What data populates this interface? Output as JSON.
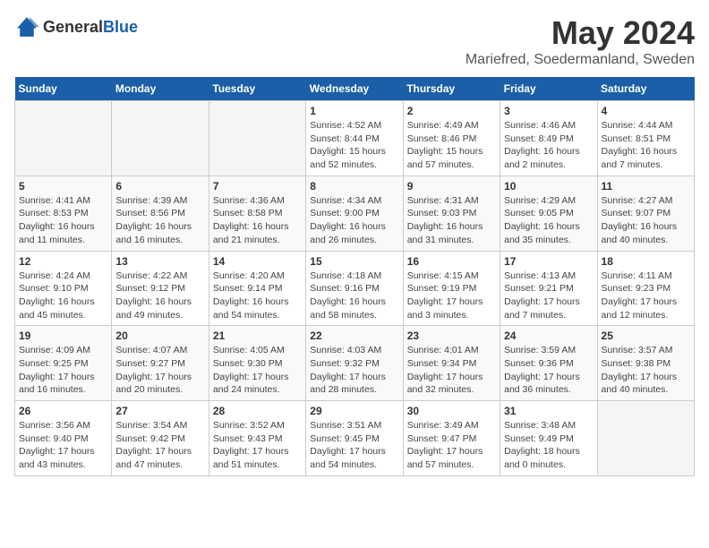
{
  "header": {
    "logo_general": "General",
    "logo_blue": "Blue",
    "title": "May 2024",
    "subtitle": "Mariefred, Soedermanland, Sweden"
  },
  "weekdays": [
    "Sunday",
    "Monday",
    "Tuesday",
    "Wednesday",
    "Thursday",
    "Friday",
    "Saturday"
  ],
  "weeks": [
    [
      {
        "day": "",
        "info": ""
      },
      {
        "day": "",
        "info": ""
      },
      {
        "day": "",
        "info": ""
      },
      {
        "day": "1",
        "info": "Sunrise: 4:52 AM\nSunset: 8:44 PM\nDaylight: 15 hours and 52 minutes."
      },
      {
        "day": "2",
        "info": "Sunrise: 4:49 AM\nSunset: 8:46 PM\nDaylight: 15 hours and 57 minutes."
      },
      {
        "day": "3",
        "info": "Sunrise: 4:46 AM\nSunset: 8:49 PM\nDaylight: 16 hours and 2 minutes."
      },
      {
        "day": "4",
        "info": "Sunrise: 4:44 AM\nSunset: 8:51 PM\nDaylight: 16 hours and 7 minutes."
      }
    ],
    [
      {
        "day": "5",
        "info": "Sunrise: 4:41 AM\nSunset: 8:53 PM\nDaylight: 16 hours and 11 minutes."
      },
      {
        "day": "6",
        "info": "Sunrise: 4:39 AM\nSunset: 8:56 PM\nDaylight: 16 hours and 16 minutes."
      },
      {
        "day": "7",
        "info": "Sunrise: 4:36 AM\nSunset: 8:58 PM\nDaylight: 16 hours and 21 minutes."
      },
      {
        "day": "8",
        "info": "Sunrise: 4:34 AM\nSunset: 9:00 PM\nDaylight: 16 hours and 26 minutes."
      },
      {
        "day": "9",
        "info": "Sunrise: 4:31 AM\nSunset: 9:03 PM\nDaylight: 16 hours and 31 minutes."
      },
      {
        "day": "10",
        "info": "Sunrise: 4:29 AM\nSunset: 9:05 PM\nDaylight: 16 hours and 35 minutes."
      },
      {
        "day": "11",
        "info": "Sunrise: 4:27 AM\nSunset: 9:07 PM\nDaylight: 16 hours and 40 minutes."
      }
    ],
    [
      {
        "day": "12",
        "info": "Sunrise: 4:24 AM\nSunset: 9:10 PM\nDaylight: 16 hours and 45 minutes."
      },
      {
        "day": "13",
        "info": "Sunrise: 4:22 AM\nSunset: 9:12 PM\nDaylight: 16 hours and 49 minutes."
      },
      {
        "day": "14",
        "info": "Sunrise: 4:20 AM\nSunset: 9:14 PM\nDaylight: 16 hours and 54 minutes."
      },
      {
        "day": "15",
        "info": "Sunrise: 4:18 AM\nSunset: 9:16 PM\nDaylight: 16 hours and 58 minutes."
      },
      {
        "day": "16",
        "info": "Sunrise: 4:15 AM\nSunset: 9:19 PM\nDaylight: 17 hours and 3 minutes."
      },
      {
        "day": "17",
        "info": "Sunrise: 4:13 AM\nSunset: 9:21 PM\nDaylight: 17 hours and 7 minutes."
      },
      {
        "day": "18",
        "info": "Sunrise: 4:11 AM\nSunset: 9:23 PM\nDaylight: 17 hours and 12 minutes."
      }
    ],
    [
      {
        "day": "19",
        "info": "Sunrise: 4:09 AM\nSunset: 9:25 PM\nDaylight: 17 hours and 16 minutes."
      },
      {
        "day": "20",
        "info": "Sunrise: 4:07 AM\nSunset: 9:27 PM\nDaylight: 17 hours and 20 minutes."
      },
      {
        "day": "21",
        "info": "Sunrise: 4:05 AM\nSunset: 9:30 PM\nDaylight: 17 hours and 24 minutes."
      },
      {
        "day": "22",
        "info": "Sunrise: 4:03 AM\nSunset: 9:32 PM\nDaylight: 17 hours and 28 minutes."
      },
      {
        "day": "23",
        "info": "Sunrise: 4:01 AM\nSunset: 9:34 PM\nDaylight: 17 hours and 32 minutes."
      },
      {
        "day": "24",
        "info": "Sunrise: 3:59 AM\nSunset: 9:36 PM\nDaylight: 17 hours and 36 minutes."
      },
      {
        "day": "25",
        "info": "Sunrise: 3:57 AM\nSunset: 9:38 PM\nDaylight: 17 hours and 40 minutes."
      }
    ],
    [
      {
        "day": "26",
        "info": "Sunrise: 3:56 AM\nSunset: 9:40 PM\nDaylight: 17 hours and 43 minutes."
      },
      {
        "day": "27",
        "info": "Sunrise: 3:54 AM\nSunset: 9:42 PM\nDaylight: 17 hours and 47 minutes."
      },
      {
        "day": "28",
        "info": "Sunrise: 3:52 AM\nSunset: 9:43 PM\nDaylight: 17 hours and 51 minutes."
      },
      {
        "day": "29",
        "info": "Sunrise: 3:51 AM\nSunset: 9:45 PM\nDaylight: 17 hours and 54 minutes."
      },
      {
        "day": "30",
        "info": "Sunrise: 3:49 AM\nSunset: 9:47 PM\nDaylight: 17 hours and 57 minutes."
      },
      {
        "day": "31",
        "info": "Sunrise: 3:48 AM\nSunset: 9:49 PM\nDaylight: 18 hours and 0 minutes."
      },
      {
        "day": "",
        "info": ""
      }
    ]
  ]
}
